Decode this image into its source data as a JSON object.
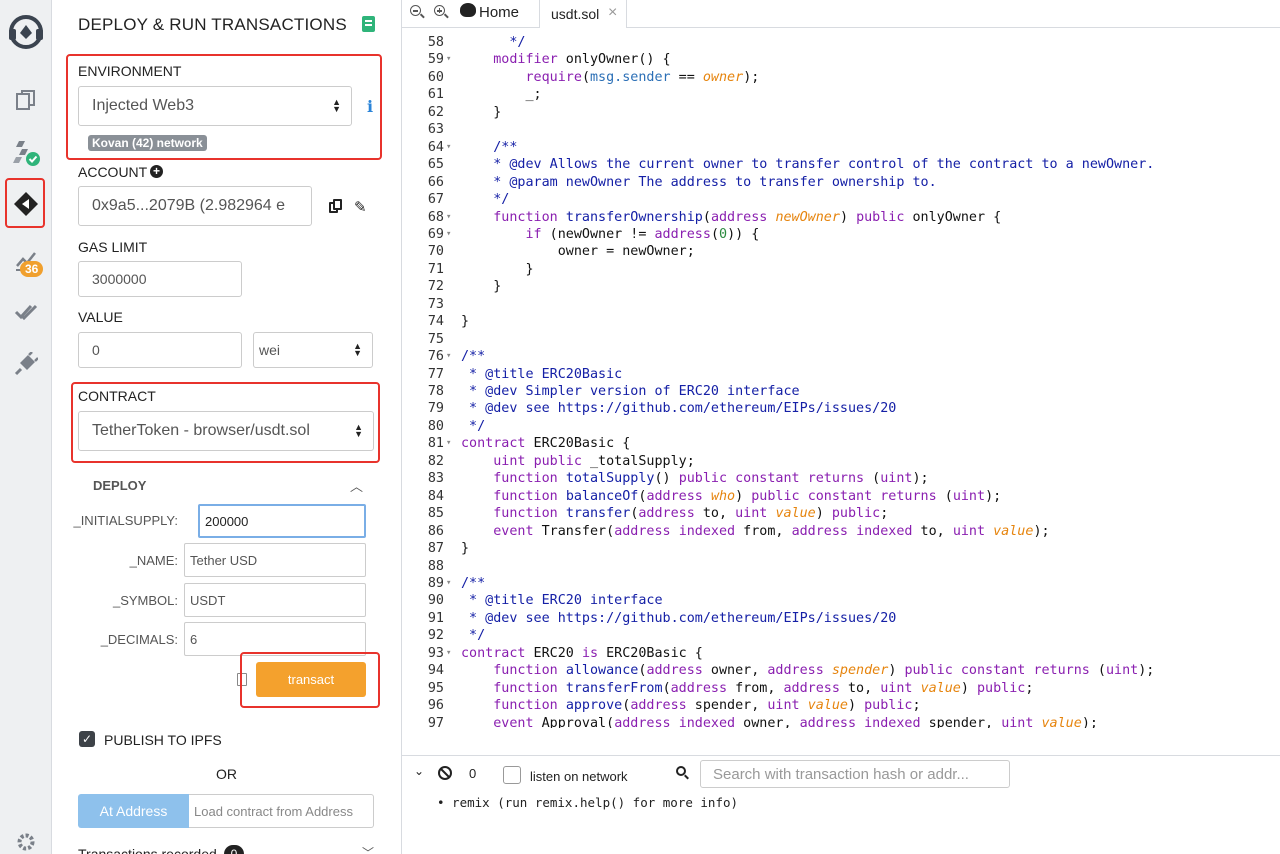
{
  "rail": {
    "badge": "36"
  },
  "panel": {
    "title": "DEPLOY & RUN TRANSACTIONS",
    "environment": {
      "label": "ENVIRONMENT",
      "value": "Injected Web3",
      "network": "Kovan (42) network"
    },
    "account": {
      "label": "ACCOUNT",
      "value": "0x9a5...2079B (2.982964 e"
    },
    "gas_limit": {
      "label": "GAS LIMIT",
      "value": "3000000"
    },
    "value": {
      "label": "VALUE",
      "amount": "0",
      "unit": "wei"
    },
    "contract": {
      "label": "CONTRACT",
      "value": "TetherToken - browser/usdt.sol"
    },
    "deploy": {
      "label": "DEPLOY",
      "args": [
        {
          "name": "_INITIALSUPPLY:",
          "value": "200000"
        },
        {
          "name": "_NAME:",
          "value": "Tether USD"
        },
        {
          "name": "_SYMBOL:",
          "value": "USDT"
        },
        {
          "name": "_DECIMALS:",
          "value": "6"
        }
      ],
      "transact_label": "transact"
    },
    "publish_label": "PUBLISH TO IPFS",
    "or_label": "OR",
    "at_address_label": "At Address",
    "load_placeholder": "Load contract from Address",
    "transactions_label": "Transactions recorded",
    "transactions_count": "0"
  },
  "tabs": {
    "home_label": "Home",
    "file_label": "usdt.sol"
  },
  "terminal": {
    "count": "0",
    "listen_label": "listen on network",
    "search_placeholder": "Search with transaction hash or addr...",
    "output": "• remix (run remix.help() for more info)"
  },
  "editor_lines": [
    {
      "n": "58",
      "code": "      */"
    },
    {
      "n": "59",
      "code": "    modifier onlyOwner() {"
    },
    {
      "n": "60",
      "code": "        require(msg.sender == owner);"
    },
    {
      "n": "61",
      "code": "        _;"
    },
    {
      "n": "62",
      "code": "    }"
    },
    {
      "n": "63",
      "code": ""
    },
    {
      "n": "64",
      "code": "    /**"
    },
    {
      "n": "65",
      "code": "    * @dev Allows the current owner to transfer control of the contract to a newOwner."
    },
    {
      "n": "66",
      "code": "    * @param newOwner The address to transfer ownership to."
    },
    {
      "n": "67",
      "code": "    */"
    },
    {
      "n": "68",
      "code": "    function transferOwnership(address newOwner) public onlyOwner {"
    },
    {
      "n": "69",
      "code": "        if (newOwner != address(0)) {"
    },
    {
      "n": "70",
      "code": "            owner = newOwner;"
    },
    {
      "n": "71",
      "code": "        }"
    },
    {
      "n": "72",
      "code": "    }"
    },
    {
      "n": "73",
      "code": ""
    },
    {
      "n": "74",
      "code": "}"
    },
    {
      "n": "75",
      "code": ""
    },
    {
      "n": "76",
      "code": "/**"
    },
    {
      "n": "77",
      "code": " * @title ERC20Basic"
    },
    {
      "n": "78",
      "code": " * @dev Simpler version of ERC20 interface"
    },
    {
      "n": "79",
      "code": " * @dev see https://github.com/ethereum/EIPs/issues/20"
    },
    {
      "n": "80",
      "code": " */"
    },
    {
      "n": "81",
      "code": "contract ERC20Basic {"
    },
    {
      "n": "82",
      "code": "    uint public _totalSupply;"
    },
    {
      "n": "83",
      "code": "    function totalSupply() public constant returns (uint);"
    },
    {
      "n": "84",
      "code": "    function balanceOf(address who) public constant returns (uint);"
    },
    {
      "n": "85",
      "code": "    function transfer(address to, uint value) public;"
    },
    {
      "n": "86",
      "code": "    event Transfer(address indexed from, address indexed to, uint value);"
    },
    {
      "n": "87",
      "code": "}"
    },
    {
      "n": "88",
      "code": ""
    },
    {
      "n": "89",
      "code": "/**"
    },
    {
      "n": "90",
      "code": " * @title ERC20 interface"
    },
    {
      "n": "91",
      "code": " * @dev see https://github.com/ethereum/EIPs/issues/20"
    },
    {
      "n": "92",
      "code": " */"
    },
    {
      "n": "93",
      "code": "contract ERC20 is ERC20Basic {"
    },
    {
      "n": "94",
      "code": "    function allowance(address owner, address spender) public constant returns (uint);"
    },
    {
      "n": "95",
      "code": "    function transferFrom(address from, address to, uint value) public;"
    },
    {
      "n": "96",
      "code": "    function approve(address spender, uint value) public;"
    },
    {
      "n": "97",
      "code": "    event Approval(address indexed owner, address indexed spender, uint value);"
    }
  ],
  "colors": {
    "accent": "#2b84d8",
    "transact": "#f4a12d",
    "highlight": "#e8332c",
    "keyword": "#8a1fb0",
    "param": "#e6840d"
  }
}
